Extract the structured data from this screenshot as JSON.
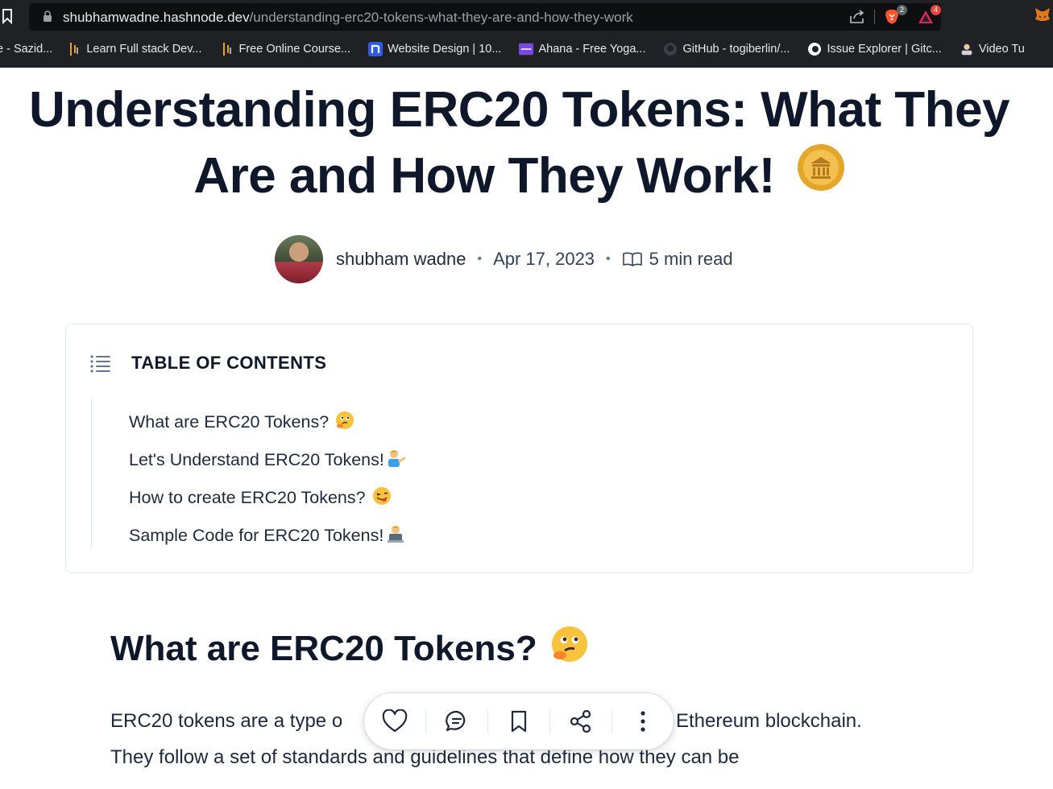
{
  "browser": {
    "url_host": "shubhamwadne.hashnode.dev",
    "url_path": "/understanding-erc20-tokens-what-they-are-and-how-they-work",
    "brave_badge": "2",
    "rewards_badge": "4",
    "bookmarks": [
      {
        "label": "e - Sazid...",
        "icon": "none"
      },
      {
        "label": "Learn Full stack Dev...",
        "icon": "bar-icon"
      },
      {
        "label": "Free Online Course...",
        "icon": "bar-icon"
      },
      {
        "label": "Website Design | 10...",
        "icon": "n-icon"
      },
      {
        "label": "Ahana - Free Yoga...",
        "icon": "colorlib-icon"
      },
      {
        "label": "GitHub - togiberlin/...",
        "icon": "github-icon"
      },
      {
        "label": "Issue Explorer | Gitc...",
        "icon": "gitcoin-icon"
      },
      {
        "label": "Video Tu",
        "icon": "avatar-icon"
      }
    ]
  },
  "article": {
    "title_line1": "Understanding ERC20 Tokens: What They",
    "title_line2": "Are and How They Work!",
    "author": "shubham wadne",
    "date": "Apr 17, 2023",
    "read_time": "5 min read"
  },
  "toc": {
    "heading": "TABLE OF CONTENTS",
    "items": [
      {
        "label": "What are ERC20 Tokens?",
        "emoji": "thinking-face"
      },
      {
        "label": "Let's Understand ERC20 Tokens!",
        "emoji": "person-tipping-hand"
      },
      {
        "label": "How to create ERC20 Tokens?",
        "emoji": "face-savoring-food"
      },
      {
        "label": "Sample Code for ERC20 Tokens!",
        "emoji": "technologist"
      }
    ]
  },
  "section": {
    "heading": "What are ERC20 Tokens?",
    "para_line1_start": "ERC20 tokens are a type o",
    "para_line1_end": "Ethereum blockchain.",
    "para_line2": "They follow a set of standards and guidelines that define how they can be"
  },
  "actions": [
    "like",
    "comment",
    "bookmark",
    "share",
    "more"
  ],
  "colors": {
    "title": "#0f172a",
    "text": "#1e293b",
    "chrome": "#202124",
    "coin": "#e3a52a"
  }
}
